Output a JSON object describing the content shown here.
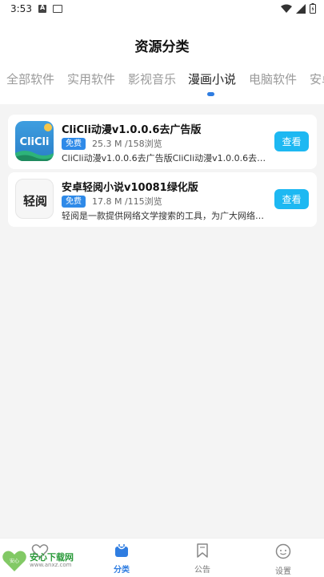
{
  "status": {
    "time": "3:53"
  },
  "page_title": "资源分类",
  "tabs": [
    {
      "label": "全部软件"
    },
    {
      "label": "实用软件"
    },
    {
      "label": "影视音乐"
    },
    {
      "label": "漫画小说"
    },
    {
      "label": "电脑软件"
    },
    {
      "label": "安卓"
    }
  ],
  "active_tab": "漫画小说",
  "items": [
    {
      "title": "CliCli动漫v1.0.0.6去广告版",
      "badge": "免费",
      "meta": "25.3 M /158浏览",
      "desc": "CliCli动漫v1.0.0.6去广告版CliCli动漫v1.0.0.6去广告...",
      "icon_text": "CliCli",
      "button": "查看"
    },
    {
      "title": "安卓轻阅小说v10081绿化版",
      "badge": "免费",
      "meta": "17.8 M /115浏览",
      "desc": "轻阅是一款提供网络文学搜索的工具，为广大网络文...",
      "icon_text": "轻阅",
      "button": "查看"
    }
  ],
  "nav": {
    "category": "分类",
    "notice": "公告",
    "settings": "设置"
  },
  "watermark": {
    "title": "安心下载网",
    "url": "www.anxz.com",
    "badge_text": "安心"
  },
  "colors": {
    "accent": "#2f7de1",
    "button": "#1db8f2",
    "badge": "#2f8ae8"
  }
}
